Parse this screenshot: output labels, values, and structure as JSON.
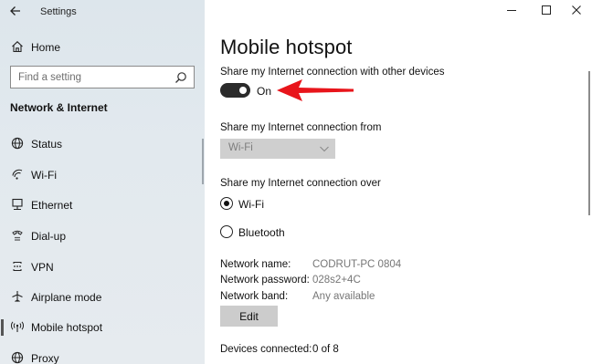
{
  "window": {
    "title": "Settings",
    "controls": [
      "minimize",
      "maximize",
      "close"
    ]
  },
  "sidebar": {
    "home_label": "Home",
    "search_placeholder": "Find a setting",
    "section_title": "Network & Internet",
    "items": [
      {
        "label": "Status",
        "icon": "globe-icon"
      },
      {
        "label": "Wi-Fi",
        "icon": "wifi-icon"
      },
      {
        "label": "Ethernet",
        "icon": "ethernet-icon"
      },
      {
        "label": "Dial-up",
        "icon": "phone-icon"
      },
      {
        "label": "VPN",
        "icon": "vpn-icon"
      },
      {
        "label": "Airplane mode",
        "icon": "airplane-icon"
      },
      {
        "label": "Mobile hotspot",
        "icon": "hotspot-icon",
        "selected": true
      },
      {
        "label": "Proxy",
        "icon": "globe-icon"
      }
    ]
  },
  "main": {
    "title": "Mobile hotspot",
    "share_label": "Share my Internet connection with other devices",
    "toggle_state": "On",
    "toggle_on": true,
    "from_label": "Share my Internet connection from",
    "from_value": "Wi-Fi",
    "over_label": "Share my Internet connection over",
    "over_options": [
      {
        "label": "Wi-Fi",
        "selected": true
      },
      {
        "label": "Bluetooth",
        "selected": false
      }
    ],
    "network_name_label": "Network name:",
    "network_name_value": "CODRUT-PC 0804",
    "network_password_label": "Network password:",
    "network_password_value": "028s2+4C",
    "network_band_label": "Network band:",
    "network_band_value": "Any available",
    "edit_label": "Edit",
    "devices_label": "Devices connected:",
    "devices_value": "0 of 8"
  },
  "colors": {
    "sidebar_bg": "#e2e9ee",
    "toggle_on": "#2b2b2b",
    "annotation_arrow": "#e8151b"
  }
}
